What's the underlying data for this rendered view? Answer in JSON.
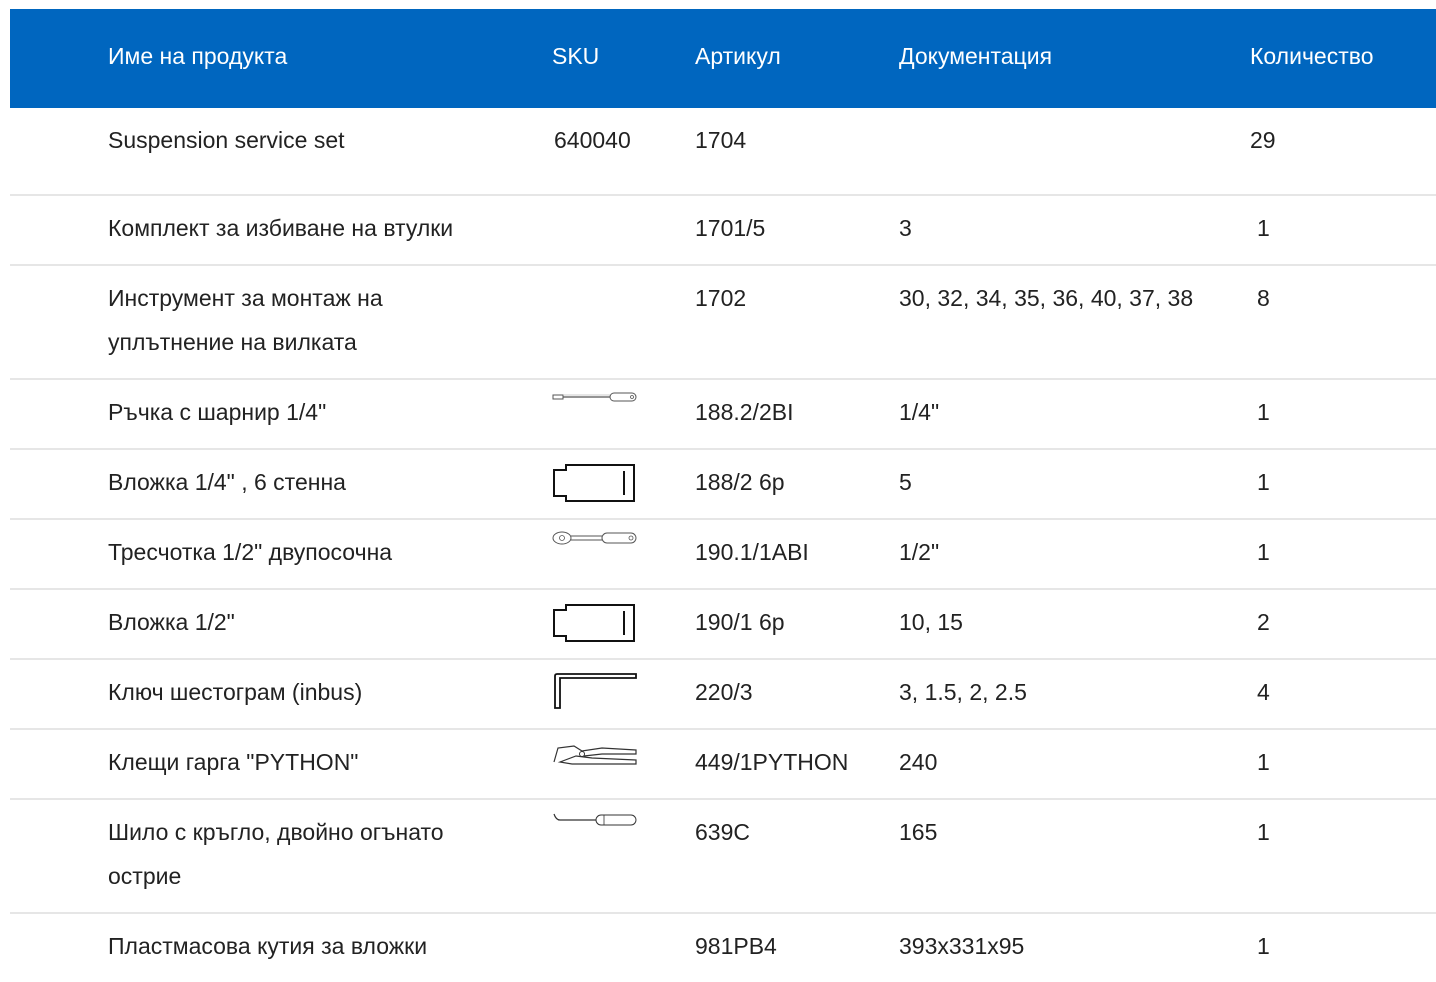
{
  "header": {
    "name": "Име на продукта",
    "sku": "SKU",
    "article": "Артикул",
    "docs": "Документация",
    "qty": "Количество"
  },
  "rows": [
    {
      "name": "Suspension service set",
      "sku": "640040",
      "article": "1704",
      "docs": "",
      "qty": "29",
      "icon": ""
    },
    {
      "name": "Комплект за избиване на втулки",
      "sku": "",
      "article": "1701/5",
      "docs": "3",
      "qty": "1",
      "icon": ""
    },
    {
      "name": "Инструмент за монтаж на уплътнение на вилката",
      "sku": "",
      "article": "1702",
      "docs": "30, 32, 34, 35, 36, 40, 37, 38",
      "qty": "8",
      "icon": ""
    },
    {
      "name": "Ръчка с шарнир 1/4\"",
      "sku": "",
      "article": "188.2/2BI",
      "docs": "1/4\"",
      "qty": "1",
      "icon": "hinged-handle-icon"
    },
    {
      "name": "Вложка 1/4\" , 6 стенна",
      "sku": "",
      "article": "188/2 6p",
      "docs": "5",
      "qty": "1",
      "icon": "socket-icon"
    },
    {
      "name": "Тресчотка 1/2\" двупосочна",
      "sku": "",
      "article": "190.1/1ABI",
      "docs": "1/2\"",
      "qty": "1",
      "icon": "ratchet-icon"
    },
    {
      "name": "Вложка 1/2\"",
      "sku": "",
      "article": "190/1 6p",
      "docs": "10, 15",
      "qty": "2",
      "icon": "socket-icon"
    },
    {
      "name": "Ключ шестограм (inbus)",
      "sku": "",
      "article": "220/3",
      "docs": "3, 1.5, 2, 2.5",
      "qty": "4",
      "icon": "hex-key-icon"
    },
    {
      "name": "Клещи гарга \"PYTHON\"",
      "sku": "",
      "article": "449/1PYTHON",
      "docs": "240",
      "qty": "1",
      "icon": "pliers-icon"
    },
    {
      "name": "Шило с кръгло, двойно огънато острие",
      "sku": "",
      "article": "639C",
      "docs": "165",
      "qty": "1",
      "icon": "awl-icon"
    },
    {
      "name": "Пластмасова кутия за вложки",
      "sku": "",
      "article": "981PB4",
      "docs": "393x331x95",
      "qty": "1",
      "icon": ""
    }
  ],
  "colors": {
    "header_bg": "#0066bf",
    "header_text": "#ffffff",
    "row_divider": "#e6e6e6",
    "text": "#222222"
  }
}
